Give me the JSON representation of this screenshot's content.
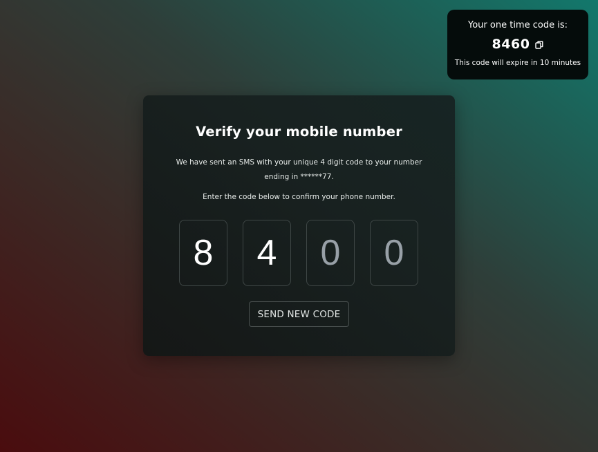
{
  "toast": {
    "title": "Your one time code is:",
    "code": "8460",
    "copy_icon": "copy-icon",
    "note": "This code will expire in 10 minutes"
  },
  "card": {
    "title": "Verify your mobile number",
    "message_line1": "We have sent an SMS with your unique 4 digit code to your number ending in ******77.",
    "message_line2": "Enter the code below to confirm your phone number.",
    "digits": [
      {
        "value": "8",
        "state": "filled"
      },
      {
        "value": "4",
        "state": "filled"
      },
      {
        "value": "0",
        "state": "placeholder"
      },
      {
        "value": "0",
        "state": "placeholder"
      }
    ],
    "send_button_label": "SEND NEW CODE"
  },
  "colors": {
    "background_red": "#4a0c0e",
    "background_teal": "#12786c",
    "card_background": "#181f1e",
    "toast_background": "#050c0b",
    "placeholder_digit": "#98a0a7"
  }
}
